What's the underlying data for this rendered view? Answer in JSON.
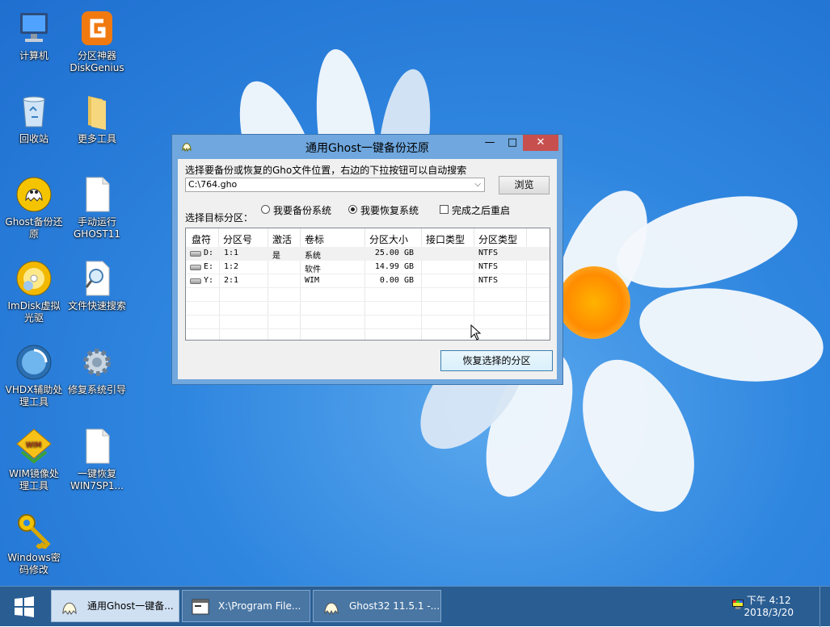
{
  "desktop": {
    "icons": [
      {
        "label": "计算机",
        "icon": "computer-icon"
      },
      {
        "label": "分区神器\nDiskGenius",
        "icon": "diskgenius-icon"
      },
      {
        "label": "回收站",
        "icon": "recycle-bin-icon"
      },
      {
        "label": "更多工具",
        "icon": "folder-icon"
      },
      {
        "label": "Ghost备份还\n原",
        "icon": "ghost-icon"
      },
      {
        "label": "手动运行\nGHOST11",
        "icon": "file-icon"
      },
      {
        "label": "ImDisk虚拟\n光驱",
        "icon": "cd-drive-icon"
      },
      {
        "label": "文件快速搜索",
        "icon": "search-file-icon"
      },
      {
        "label": "VHDX辅助处\n理工具",
        "icon": "vhdx-icon"
      },
      {
        "label": "修复系统引导",
        "icon": "gear-icon"
      },
      {
        "label": "WIM镜像处\n理工具",
        "icon": "wim-icon"
      },
      {
        "label": "一键恢复\nWIN7SP1...",
        "icon": "file-icon"
      },
      {
        "label": "Windows密\n码修改",
        "icon": "key-icon"
      }
    ]
  },
  "window": {
    "title": "通用Ghost一键备份还原",
    "controls": {
      "minimize": "—",
      "maximize": "□",
      "close": "✕"
    },
    "prompt_label": "选择要备份或恢复的Gho文件位置，右边的下拉按钮可以自动搜索",
    "path_value": "C:\\764.gho",
    "browse_label": "浏览",
    "target_label": "选择目标分区：",
    "options": {
      "backup": "我要备份系统",
      "restore": "我要恢复系统",
      "reboot": "完成之后重启"
    },
    "restore_checked": true,
    "reboot_checked": false,
    "table": {
      "headers": [
        "盘符",
        "分区号",
        "激活",
        "卷标",
        "分区大小",
        "接口类型",
        "分区类型"
      ],
      "rows": [
        {
          "drive": "D:",
          "part": "1:1",
          "active": "是",
          "label": "系统",
          "size": "25.00 GB",
          "iface": "",
          "type": "NTFS"
        },
        {
          "drive": "E:",
          "part": "1:2",
          "active": "",
          "label": "软件",
          "size": "14.99 GB",
          "iface": "",
          "type": "NTFS"
        },
        {
          "drive": "Y:",
          "part": "2:1",
          "active": "",
          "label": "WIM",
          "size": "0.00 GB",
          "iface": "",
          "type": "NTFS"
        }
      ]
    },
    "restore_button": "恢复选择的分区"
  },
  "taskbar": {
    "items": [
      {
        "label": "通用Ghost一键备...",
        "icon": "ghost-icon",
        "active": true
      },
      {
        "label": "X:\\Program File...",
        "icon": "console-icon",
        "active": false
      },
      {
        "label": "Ghost32 11.5.1 -...",
        "icon": "ghost-icon",
        "active": false
      }
    ],
    "clock_time": "下午 4:12",
    "clock_date": "2018/3/20"
  }
}
